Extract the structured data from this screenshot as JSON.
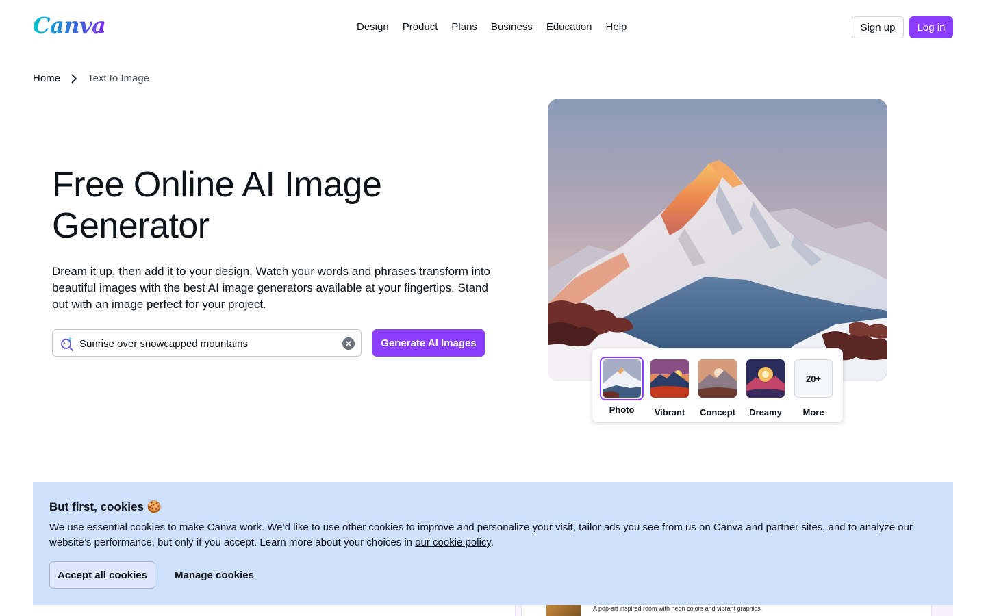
{
  "header": {
    "logo_text": "Canva",
    "nav": [
      "Design",
      "Product",
      "Plans",
      "Business",
      "Education",
      "Help"
    ],
    "signup_label": "Sign up",
    "login_label": "Log in"
  },
  "breadcrumb": {
    "home": "Home",
    "current": "Text to Image"
  },
  "hero": {
    "title": "Free Online AI Image Generator",
    "description": "Dream it up, then add it to your design. Watch your words and phrases transform into beautiful images with the best AI image generators available at your fingertips. Stand out with an image perfect for your project.",
    "search_value": "Sunrise over snowcapped mountains",
    "generate_label": "Generate AI Images"
  },
  "styles": {
    "options": [
      {
        "label": "Photo",
        "selected": true
      },
      {
        "label": "Vibrant",
        "selected": false
      },
      {
        "label": "Concept",
        "selected": false
      },
      {
        "label": "Dreamy",
        "selected": false
      }
    ],
    "more_badge": "20+",
    "more_label": "More"
  },
  "peek": {
    "caption": "A pop-art inspired room with neon colors and vibrant graphics."
  },
  "cookie": {
    "title": "But first, cookies 🍪",
    "text_before_link": "We use essential cookies to make Canva work. We’d like to use other cookies to improve and personalize your visit, tailor ads you see from us on Canva and partner sites, and to analyze our website’s performance, but only if you accept. Learn more about your choices in ",
    "link_text": "our cookie policy",
    "text_after_link": ".",
    "accept_label": "Accept all cookies",
    "manage_label": "Manage cookies"
  },
  "colors": {
    "accent": "#8b3dff",
    "cookie_bg": "#cfe0fd",
    "text": "#0e1318"
  }
}
